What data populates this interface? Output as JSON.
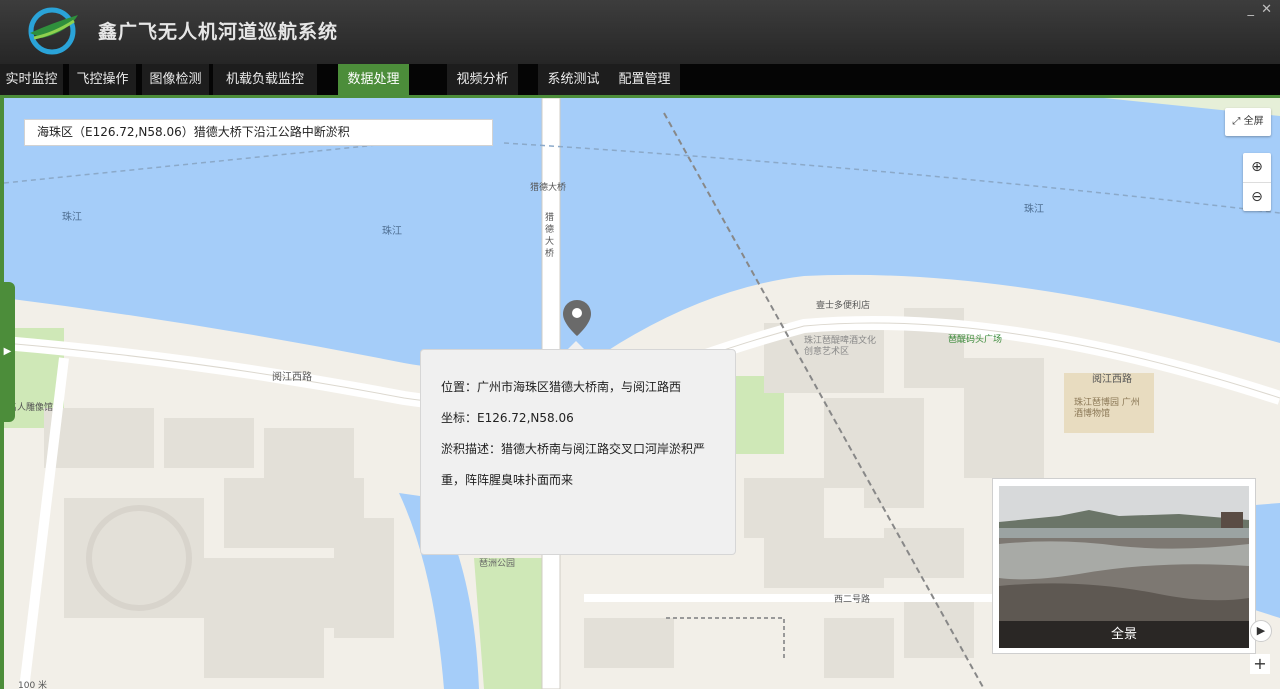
{
  "app": {
    "title": "鑫广飞无人机河道巡航系统"
  },
  "window_controls": {
    "minimize": "_",
    "close": "✕"
  },
  "menu": [
    {
      "label": "实时监控",
      "active": false
    },
    {
      "label": "飞控操作",
      "active": false
    },
    {
      "label": "图像检测",
      "active": false
    },
    {
      "label": "机载负载监控",
      "active": false
    },
    {
      "label": "数据处理",
      "active": true
    },
    {
      "label": "视频分析",
      "active": false
    },
    {
      "label": "系统测试",
      "active": false
    },
    {
      "label": "配置管理",
      "active": false
    }
  ],
  "location_bar": {
    "text": "海珠区（E126.72,N58.06）猎德大桥下沿江公路中断淤积"
  },
  "map_controls": {
    "fullscreen": "全屏",
    "zoom_in": "⊕",
    "zoom_out": "⊖"
  },
  "popup": {
    "position": "位置：广州市海珠区猎德大桥南，与阅江路西",
    "coords": "坐标：E126.72,N58.06",
    "desc_line1": "淤积描述：猎德大桥南与阅江路交叉口河岸淤积严",
    "desc_line2": "重，阵阵腥臭味扑面而来"
  },
  "photo": {
    "caption": "全景"
  },
  "map_labels": {
    "bridge1": "猎德大桥",
    "bridge2_a": "猎",
    "bridge2_b": "德",
    "bridge2_c": "大",
    "bridge2_d": "桥",
    "river1": "珠江",
    "river2": "珠江",
    "river3": "珠江",
    "road1": "阅江西路",
    "road2": "阅江西路",
    "road3": "西二号路",
    "shop": "壹士多便利店",
    "plaza": "琶醍码头广场",
    "park": "珠江琶醍啤酒文化创意艺术区",
    "museum": "珠江琶博园 广州酒博物馆",
    "park2": "琶洲公园",
    "left1": "名人雕像馆",
    "scale": "100 米"
  },
  "colors": {
    "accent": "#4c8d3a",
    "water": "#a5cdf9",
    "land": "#f2efe8",
    "park": "#cfe8b7"
  }
}
